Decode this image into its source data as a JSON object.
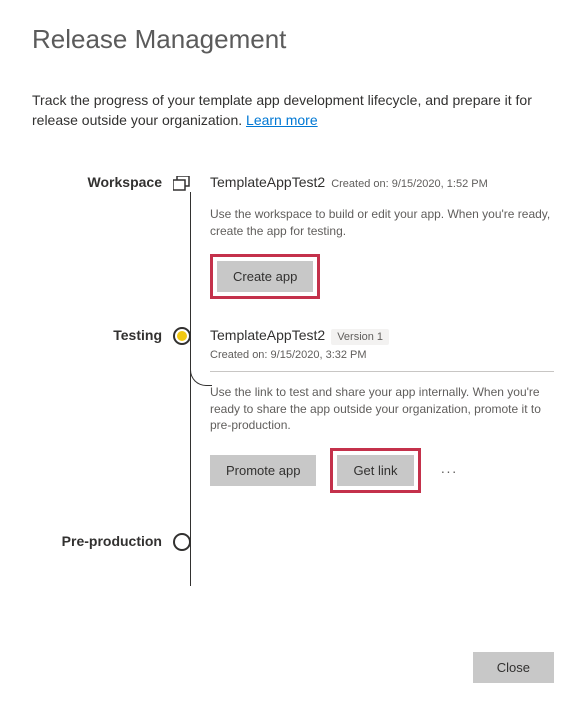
{
  "title": "Release Management",
  "description_pre": "Track the progress of your template app development lifecycle, and prepare it for release outside your organization. ",
  "learn_more_label": "Learn more",
  "stages": {
    "workspace": {
      "label": "Workspace",
      "name": "TemplateAppTest2",
      "created": "Created on: 9/15/2020, 1:52 PM",
      "help": "Use the workspace to build or edit your app. When you're ready, create the app for testing.",
      "create_app_label": "Create app"
    },
    "testing": {
      "label": "Testing",
      "name": "TemplateAppTest2",
      "version": "Version 1",
      "created": "Created on: 9/15/2020, 3:32 PM",
      "help": "Use the link to test and share your app internally. When you're ready to share the app outside your organization, promote it to pre-production.",
      "promote_label": "Promote app",
      "get_link_label": "Get link",
      "more_label": "···"
    },
    "preproduction": {
      "label": "Pre-production"
    }
  },
  "footer": {
    "close_label": "Close"
  }
}
